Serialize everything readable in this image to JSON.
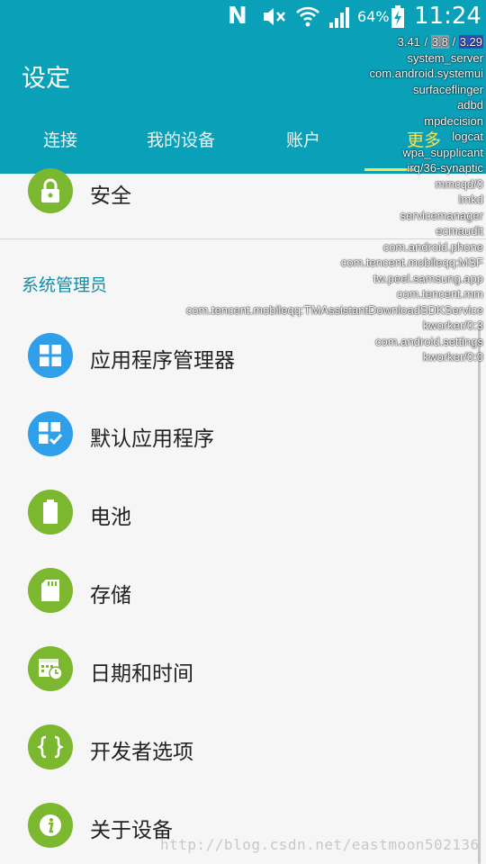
{
  "status_bar": {
    "n_icon": "N",
    "battery_percent": "64%",
    "time": "11:24"
  },
  "header": {
    "title": "设定",
    "tabs": [
      {
        "label": "连接"
      },
      {
        "label": "我的设备"
      },
      {
        "label": "账户"
      },
      {
        "label": "更多",
        "selected": true
      }
    ]
  },
  "list": {
    "top_item": {
      "label": "安全",
      "icon": "lock-icon"
    },
    "section_header": "系统管理员",
    "items": [
      {
        "label": "应用程序管理器",
        "icon": "grid-icon"
      },
      {
        "label": "默认应用程序",
        "icon": "grid-check-icon"
      },
      {
        "label": "电池",
        "icon": "battery-icon"
      },
      {
        "label": "存储",
        "icon": "sd-card-icon"
      },
      {
        "label": "日期和时间",
        "icon": "calendar-clock-icon"
      },
      {
        "label": "开发者选项",
        "icon": "braces-icon"
      },
      {
        "label": "关于设备",
        "icon": "info-icon"
      }
    ]
  },
  "overlay": {
    "load": [
      "3.41",
      "3.8",
      "3.29"
    ],
    "processes": [
      "system_server",
      "com.android.systemui",
      "surfaceflinger",
      "adbd",
      "mpdecision",
      "logcat",
      "wpa_supplicant",
      "irq/36-synaptic",
      "mmcqd/0",
      "lmkd",
      "servicemanager",
      "ecmaudit",
      "com.android.phone",
      "com.tencent.mobileqq:MSF",
      "tw.peel.samsung.app",
      "com.tencent.mm",
      "com.tencent.mobileqq:TMAssistantDownloadSDKService",
      "kworker/0:3",
      "com.android.settings",
      "kworker/0:0"
    ]
  },
  "watermark": "http://blog.csdn.net/eastmoon502136",
  "colors": {
    "header": "#0aa0b8",
    "selected_tab": "#ffe14a",
    "section_header": "#0d8ea5",
    "icon_green": "#7cb82f",
    "icon_blue": "#2e9fe8"
  }
}
